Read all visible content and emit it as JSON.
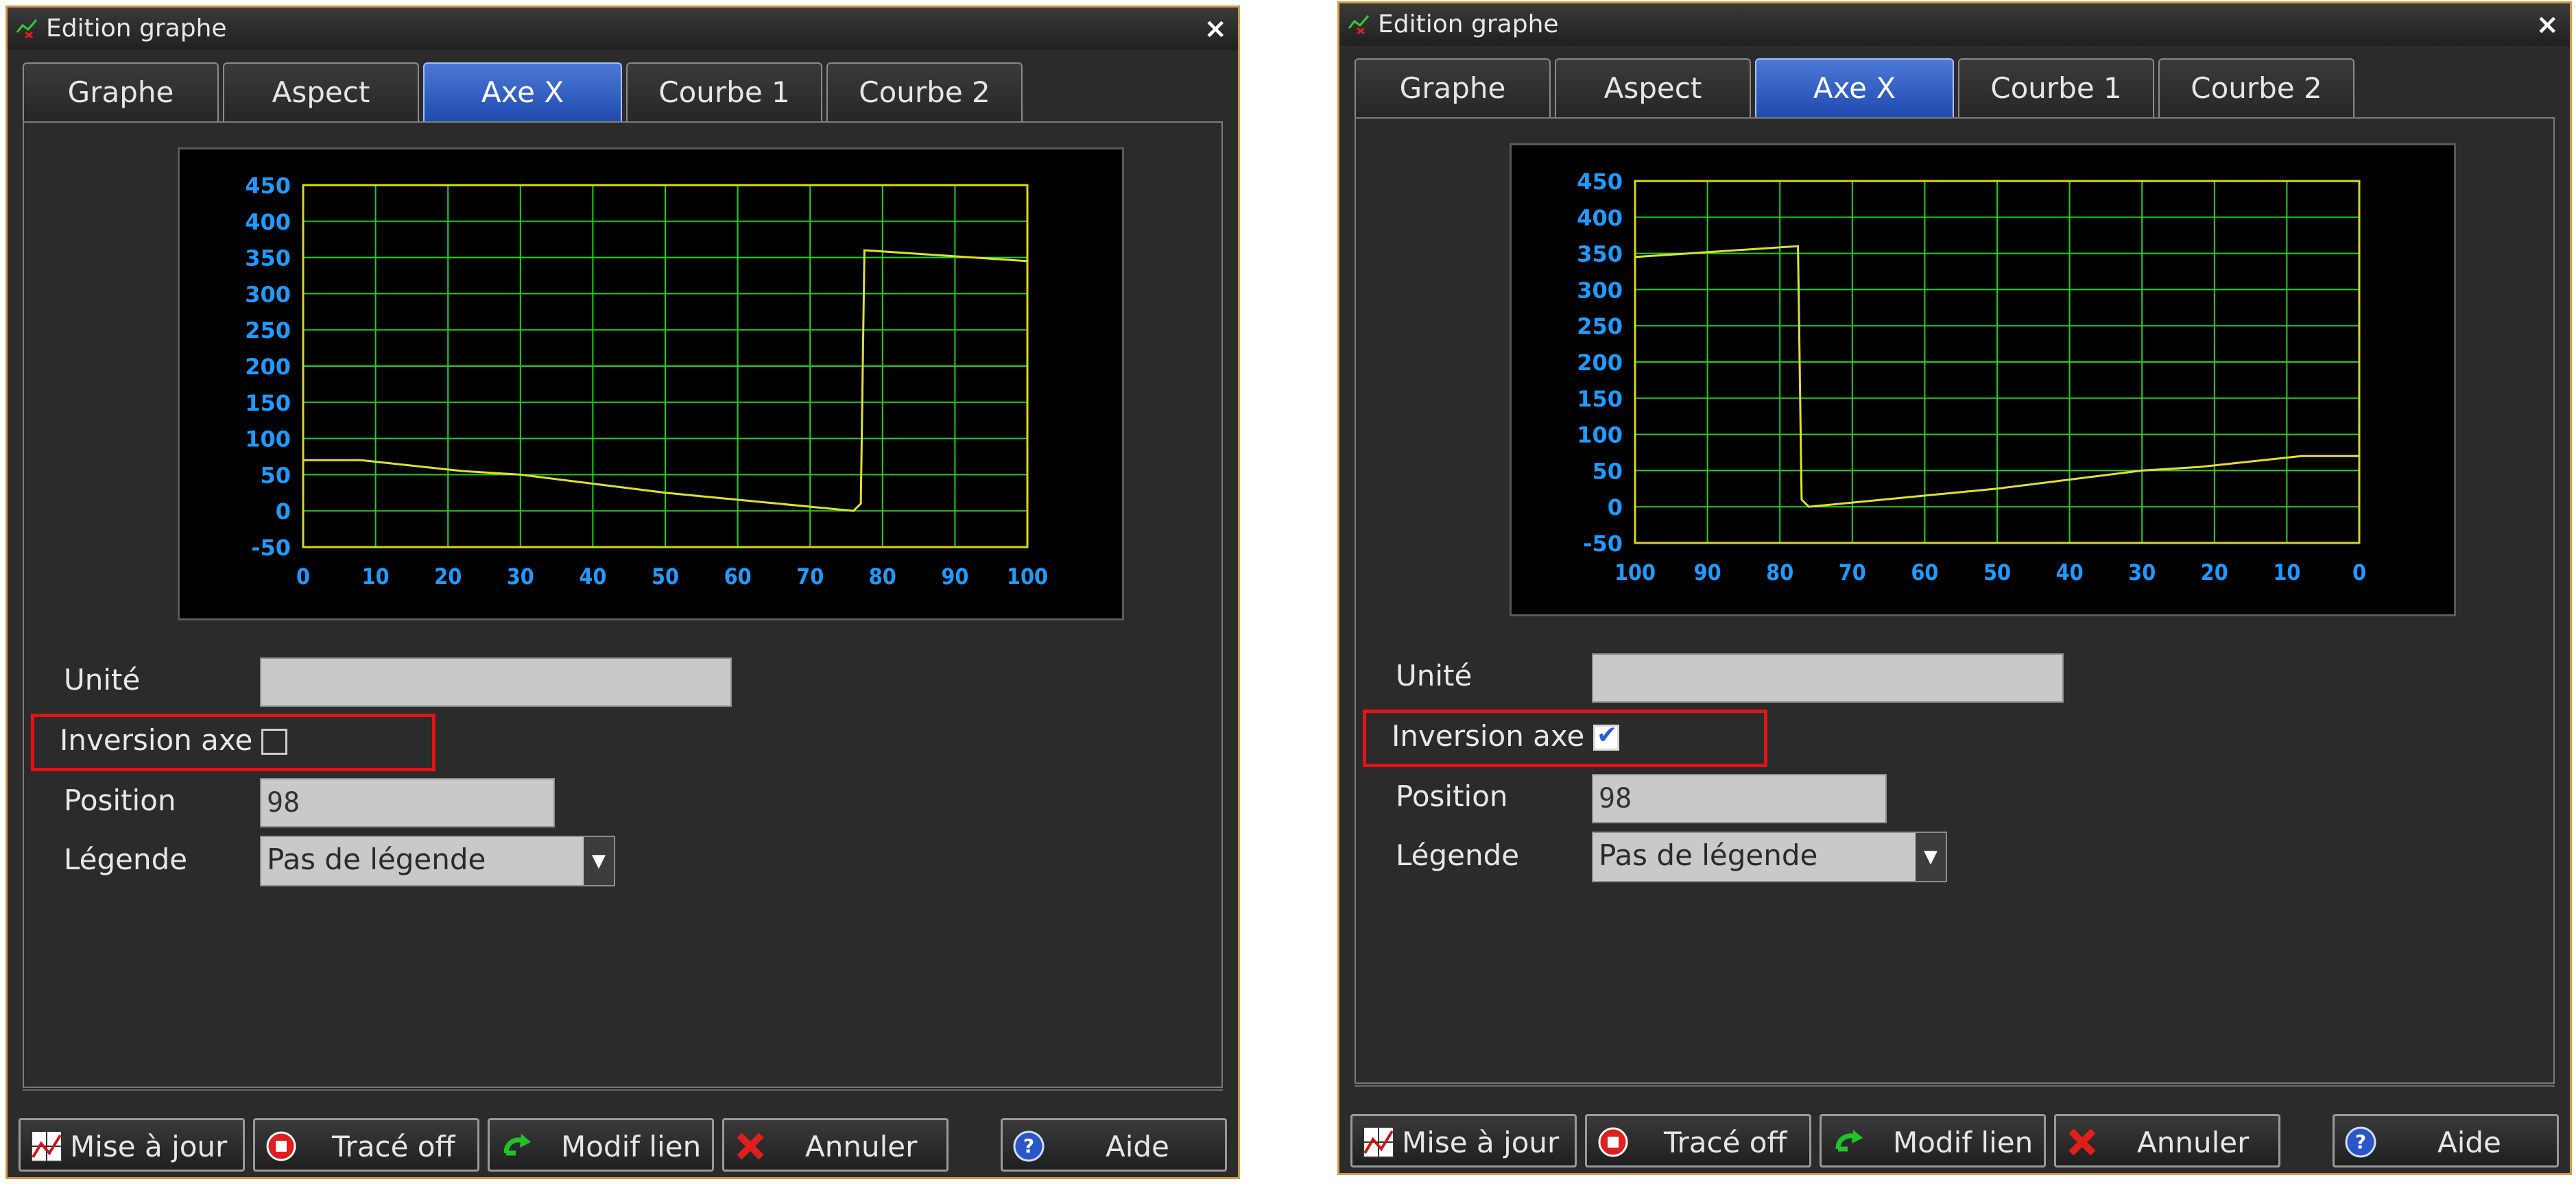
{
  "panels": [
    {
      "title": "Edition graphe",
      "close_symbol": "×",
      "tabs": [
        {
          "label": "Graphe",
          "active": false
        },
        {
          "label": "Aspect",
          "active": false
        },
        {
          "label": "Axe X",
          "active": true
        },
        {
          "label": "Courbe 1",
          "active": false
        },
        {
          "label": "Courbe 2",
          "active": false
        }
      ],
      "chart_data": {
        "type": "line",
        "x_ticks": [
          "0",
          "10",
          "20",
          "30",
          "40",
          "50",
          "60",
          "70",
          "80",
          "90",
          "100"
        ],
        "y_ticks": [
          "450",
          "400",
          "350",
          "300",
          "250",
          "200",
          "150",
          "100",
          "50",
          "0",
          "-50"
        ],
        "xlim": [
          0,
          100
        ],
        "ylim": [
          -50,
          450
        ],
        "x_inverted": false,
        "grid": true,
        "series": [
          {
            "x": [
              0,
              8,
              22,
              30,
              50,
              76,
              77,
              77.5,
              100
            ],
            "y": [
              70,
              70,
              55,
              50,
              25,
              0,
              10,
              360,
              345
            ]
          }
        ]
      },
      "form": {
        "unite_label": "Unité",
        "unite_value": "",
        "inversion_label": "Inversion axe",
        "inversion_checked": false,
        "position_label": "Position",
        "position_value": "98",
        "legende_label": "Légende",
        "legende_value": "Pas de légende"
      },
      "buttons": {
        "update": "Mise à jour",
        "trace_off": "Tracé off",
        "modif_lien": "Modif lien",
        "annuler": "Annuler",
        "aide": "Aide"
      }
    },
    {
      "title": "Edition graphe",
      "close_symbol": "×",
      "tabs": [
        {
          "label": "Graphe",
          "active": false
        },
        {
          "label": "Aspect",
          "active": false
        },
        {
          "label": "Axe X",
          "active": true
        },
        {
          "label": "Courbe 1",
          "active": false
        },
        {
          "label": "Courbe 2",
          "active": false
        }
      ],
      "chart_data": {
        "type": "line",
        "x_ticks": [
          "100",
          "90",
          "80",
          "70",
          "60",
          "50",
          "40",
          "30",
          "20",
          "10",
          "0"
        ],
        "y_ticks": [
          "450",
          "400",
          "350",
          "300",
          "250",
          "200",
          "150",
          "100",
          "50",
          "0",
          "-50"
        ],
        "xlim": [
          0,
          100
        ],
        "ylim": [
          -50,
          450
        ],
        "x_inverted": true,
        "grid": true,
        "series": [
          {
            "x": [
              0,
              8,
              22,
              30,
              50,
              76,
              77,
              77.5,
              100
            ],
            "y": [
              70,
              70,
              55,
              50,
              25,
              0,
              10,
              360,
              345
            ]
          }
        ]
      },
      "form": {
        "unite_label": "Unité",
        "unite_value": "",
        "inversion_label": "Inversion axe",
        "inversion_checked": true,
        "position_label": "Position",
        "position_value": "98",
        "legende_label": "Légende",
        "legende_value": "Pas de légende"
      },
      "buttons": {
        "update": "Mise à jour",
        "trace_off": "Tracé off",
        "modif_lien": "Modif lien",
        "annuler": "Annuler",
        "aide": "Aide"
      }
    }
  ],
  "colors": {
    "accent_tab": "#2f5fc4",
    "chart_grid": "#1fd11f",
    "chart_frame": "#d8d818",
    "chart_line": "#e0e02a",
    "tick_labels": "#1e9bff",
    "highlight": "#e21414",
    "dialog_border": "#d89a3c"
  },
  "icons": {
    "app": "graph-app-icon",
    "update": "chart-update-icon",
    "trace_off": "stop-icon",
    "modif_lien": "link-arrow-icon",
    "annuler": "cancel-x-icon",
    "aide": "help-icon",
    "select": "chevron-down-icon"
  }
}
